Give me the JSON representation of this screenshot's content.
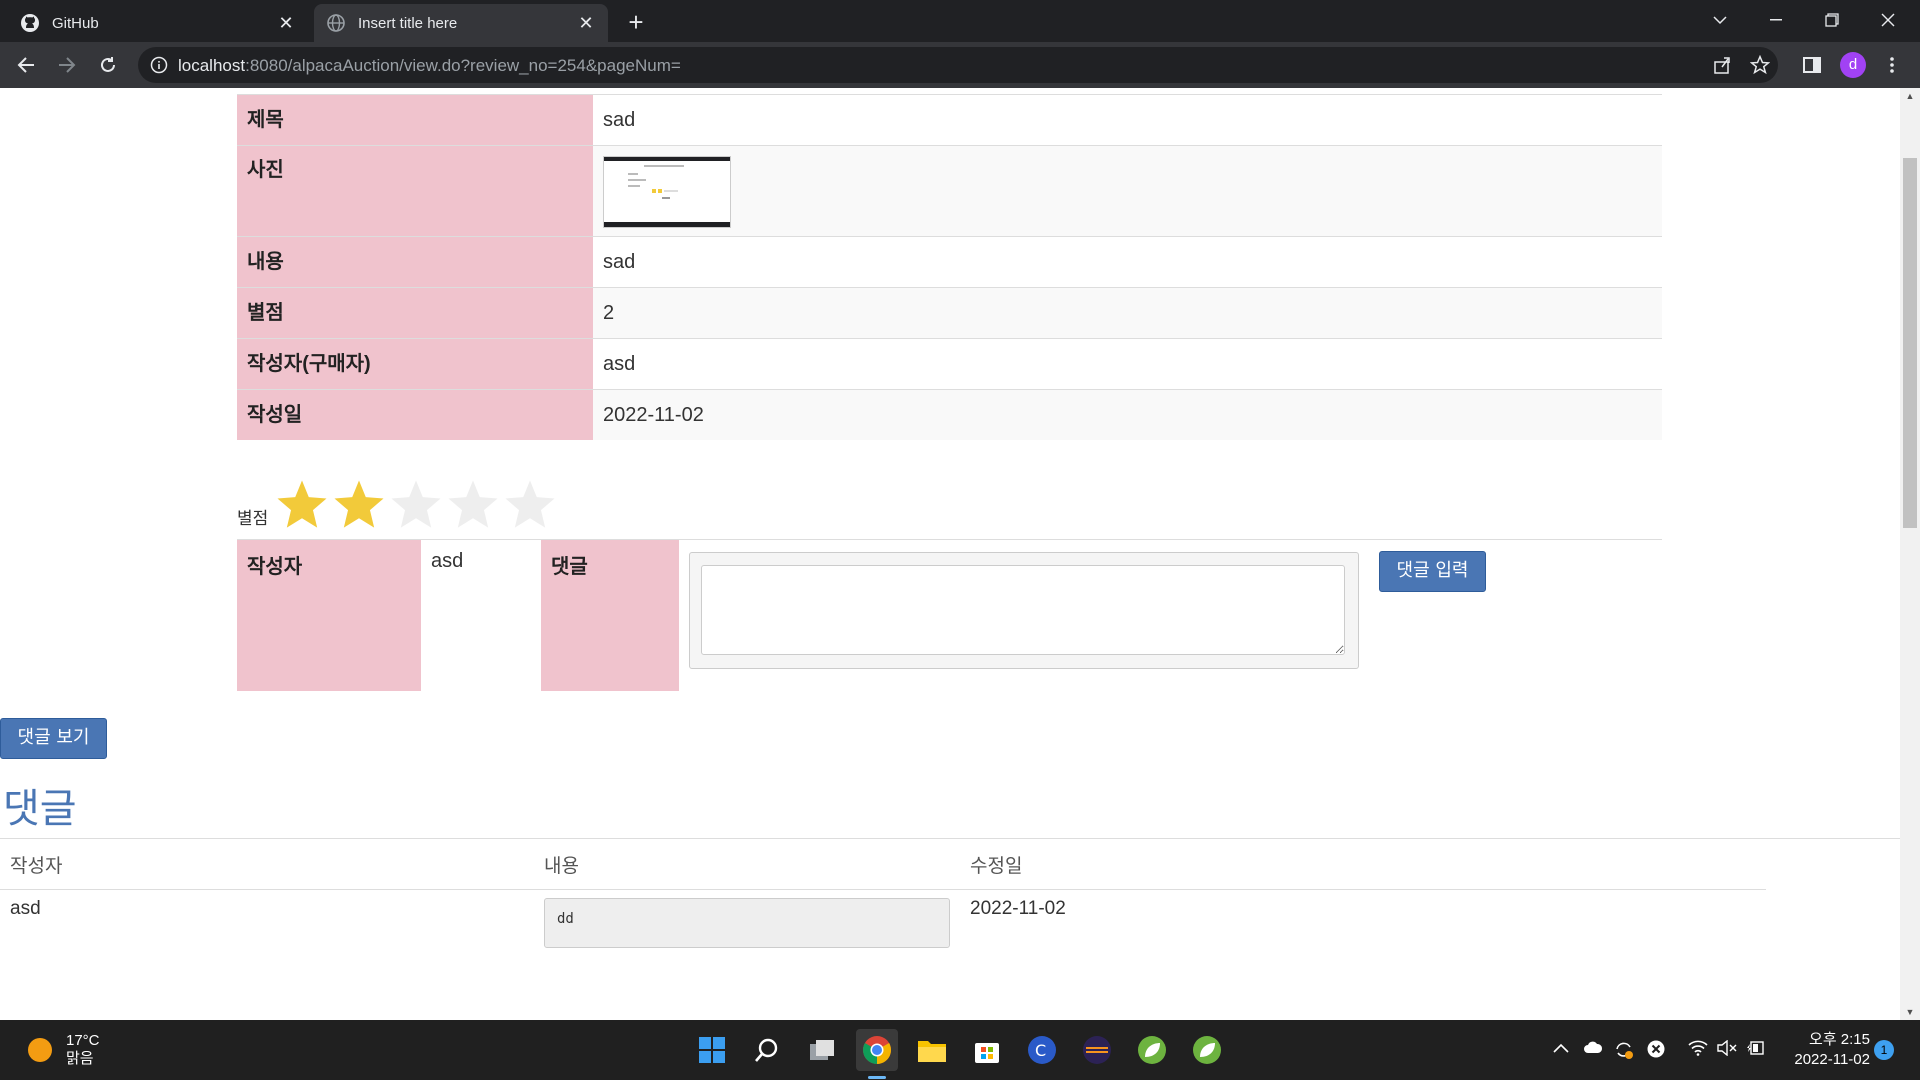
{
  "browser": {
    "tabs": [
      {
        "title": "GitHub",
        "icon": "github-icon"
      },
      {
        "title": "Insert title here",
        "icon": "globe-icon"
      }
    ],
    "url_host": "localhost",
    "url_rest": ":8080/alpacaAuction/view.do?review_no=254&pageNum=",
    "profile_initial": "d"
  },
  "review": {
    "rows": [
      {
        "label": "제목",
        "value": "sad"
      },
      {
        "label": "사진",
        "value": ""
      },
      {
        "label": "내용",
        "value": "sad"
      },
      {
        "label": "별점",
        "value": "2"
      },
      {
        "label": "작성자(구매자)",
        "value": "asd"
      },
      {
        "label": "작성일",
        "value": "2022-11-02"
      }
    ],
    "rating_label": "별점",
    "rating": 2,
    "rating_max": 5,
    "star_filled_color": "#f2ca3a",
    "star_empty_color": "#eeeeee"
  },
  "comment_form": {
    "writer_label": "작성자",
    "writer_value": "asd",
    "comment_label": "댓글",
    "comment_value": "",
    "submit_label": "댓글 입력"
  },
  "view_comments_label": "댓글 보기",
  "comments": {
    "heading": "댓글",
    "headers": [
      "작성자",
      "내용",
      "수정일"
    ],
    "rows": [
      {
        "writer": "asd",
        "content": "dd",
        "date": "2022-11-02"
      }
    ]
  },
  "taskbar": {
    "temperature": "17°C",
    "weather": "맑음",
    "time": "오후 2:15",
    "date": "2022-11-02",
    "notifications": "1"
  },
  "colors": {
    "label_bg": "#f0c3cd",
    "accent": "#4a76b4"
  }
}
